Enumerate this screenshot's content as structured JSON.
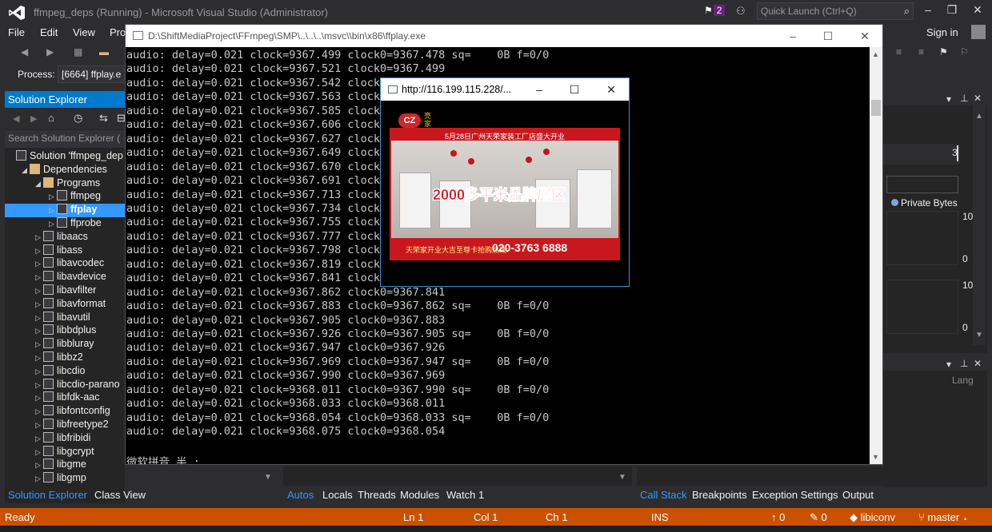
{
  "vs": {
    "title": "ffmpeg_deps (Running) - Microsoft Visual Studio (Administrator)",
    "notifications_count": "2",
    "quick_launch_placeholder": "Quick Launch (Ctrl+Q)",
    "sign_in": "Sign in",
    "menu": [
      "File",
      "Edit",
      "View",
      "Pro"
    ],
    "process_label": "Process:",
    "process_value": "[6664] ffplay.e",
    "solution_explorer": {
      "title": "Solution Explorer",
      "search_placeholder": "Search Solution Explorer (",
      "items": [
        {
          "label": "Solution 'ffmpeg_dep"
        },
        {
          "label": "Dependencies"
        },
        {
          "label": "Programs"
        },
        {
          "label": "ffmpeg"
        },
        {
          "label": "ffplay"
        },
        {
          "label": "ffprobe"
        },
        {
          "label": "libaacs"
        },
        {
          "label": "libass"
        },
        {
          "label": "libavcodec"
        },
        {
          "label": "libavdevice"
        },
        {
          "label": "libavfilter"
        },
        {
          "label": "libavformat"
        },
        {
          "label": "libavutil"
        },
        {
          "label": "libbdplus"
        },
        {
          "label": "libbluray"
        },
        {
          "label": "libbz2"
        },
        {
          "label": "libcdio"
        },
        {
          "label": "libcdio-parano"
        },
        {
          "label": "libfdk-aac"
        },
        {
          "label": "libfontconfig"
        },
        {
          "label": "libfreetype2"
        },
        {
          "label": "libfribidi"
        },
        {
          "label": "libgcrypt"
        },
        {
          "label": "libgme"
        },
        {
          "label": "libgmp"
        }
      ]
    },
    "bottom_tabs_left": [
      "Solution Explorer",
      "Class View"
    ],
    "bottom_tabs_middle": [
      "Autos",
      "Locals",
      "Threads",
      "Modules",
      "Watch 1"
    ],
    "bottom_tabs_right": [
      "Call Stack",
      "Breakpoints",
      "Exception Settings",
      "Output"
    ],
    "diagnostics": {
      "private_bytes": "Private Bytes",
      "axis": [
        "10",
        "0",
        "10",
        "0"
      ],
      "lang": "Lang"
    },
    "status": {
      "ready": "Ready",
      "ln": "Ln 1",
      "col": "Col 1",
      "ch": "Ch 1",
      "ins": "INS",
      "up": "0",
      "edits": "0",
      "repo": "libiconv",
      "branch": "master"
    },
    "colors": {
      "accent": "#007acc",
      "status_bar": "#ca5100"
    }
  },
  "console": {
    "title": "D:\\ShiftMediaProject\\FFmpeg\\SMP\\..\\..\\..\\msvc\\\\bin\\x86\\ffplay.exe",
    "lines": [
      "audio: delay=0.021 clock=9367.499 clock0=9367.478 sq=    0B f=0/0",
      "audio: delay=0.021 clock=9367.521 clock0=9367.499",
      "audio: delay=0.021 clock=9367.542 clock0=",
      "audio: delay=0.021 clock=9367.563 clock0=",
      "audio: delay=0.021 clock=9367.585 clock0=",
      "audio: delay=0.021 clock=9367.606 clock0=",
      "audio: delay=0.021 clock=9367.627 clock0=",
      "audio: delay=0.021 clock=9367.649 clock0=",
      "audio: delay=0.021 clock=9367.670 clock0=",
      "audio: delay=0.021 clock=9367.691 clock0=",
      "audio: delay=0.021 clock=9367.713 clock0=",
      "audio: delay=0.021 clock=9367.734 clock0=",
      "audio: delay=0.021 clock=9367.755 clock0=",
      "audio: delay=0.021 clock=9367.777 clock0=",
      "audio: delay=0.021 clock=9367.798 clock0=",
      "audio: delay=0.021 clock=9367.819 clock0=",
      "audio: delay=0.021 clock=9367.841 clock0=",
      "audio: delay=0.021 clock=9367.862 clock0=9367.841",
      "audio: delay=0.021 clock=9367.883 clock0=9367.862 sq=    0B f=0/0",
      "audio: delay=0.021 clock=9367.905 clock0=9367.883",
      "audio: delay=0.021 clock=9367.926 clock0=9367.905 sq=    0B f=0/0",
      "audio: delay=0.021 clock=9367.947 clock0=9367.926",
      "audio: delay=0.021 clock=9367.969 clock0=9367.947 sq=    0B f=0/0",
      "audio: delay=0.021 clock=9367.990 clock0=9367.969",
      "audio: delay=0.021 clock=9368.011 clock0=9367.990 sq=    0B f=0/0",
      "audio: delay=0.021 clock=9368.033 clock0=9368.011",
      "audio: delay=0.021 clock=9368.054 clock0=9368.033 sq=    0B f=0/0",
      "audio: delay=0.021 clock=9368.075 clock0=9368.054",
      "",
      "微软拼音 半 :"
    ]
  },
  "video": {
    "title": "http://116.199.115.228/...",
    "logo": "CZ",
    "logo_text": "亮\n家",
    "banner_top": "5月28日广州天荣家装工厂店盛大开业",
    "caption": "2000多平米品牌展区",
    "bottom_text": "天荣家开业大吉至尊卡抢购热线:",
    "phone": "020-3763 6888"
  }
}
